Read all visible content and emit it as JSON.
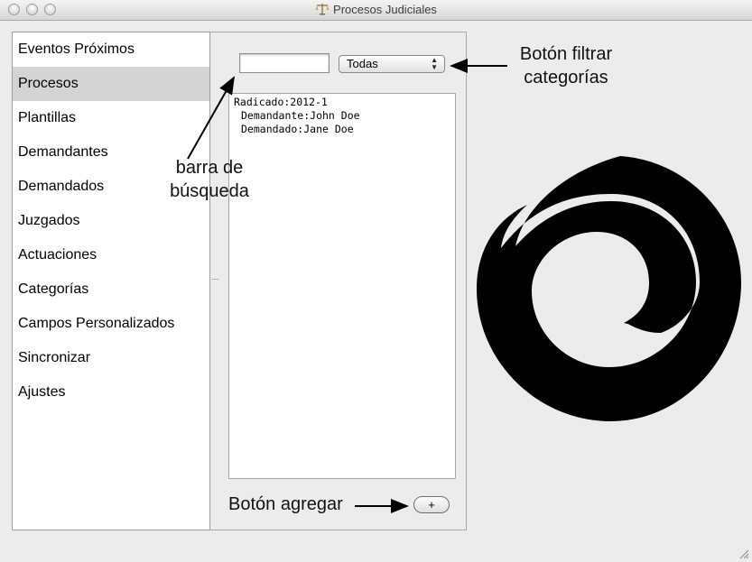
{
  "window": {
    "title": "Procesos Judiciales",
    "app_icon": "scales-icon"
  },
  "sidebar": {
    "items": [
      {
        "label": "Eventos Próximos",
        "selected": false
      },
      {
        "label": "Procesos",
        "selected": true
      },
      {
        "label": "Plantillas",
        "selected": false
      },
      {
        "label": "Demandantes",
        "selected": false
      },
      {
        "label": "Demandados",
        "selected": false
      },
      {
        "label": "Juzgados",
        "selected": false
      },
      {
        "label": "Actuaciones",
        "selected": false
      },
      {
        "label": "Categorías",
        "selected": false
      },
      {
        "label": "Campos Personalizados",
        "selected": false
      },
      {
        "label": "Sincronizar",
        "selected": false
      },
      {
        "label": "Ajustes",
        "selected": false
      }
    ]
  },
  "panel": {
    "search_value": "",
    "filter_selected": "Todas",
    "list": {
      "radicado": "Radicado:2012-1",
      "demandante": "Demandante:John Doe",
      "demandado": "Demandado:Jane Doe"
    },
    "add_label": "+"
  },
  "annotations": {
    "filter_line1": "Botón filtrar",
    "filter_line2": "categorías",
    "search_line1": "barra de",
    "search_line2": "búsqueda",
    "add": "Botón agregar"
  },
  "colors": {
    "selected_row": "#d4d4d4",
    "logo": "#000000"
  }
}
